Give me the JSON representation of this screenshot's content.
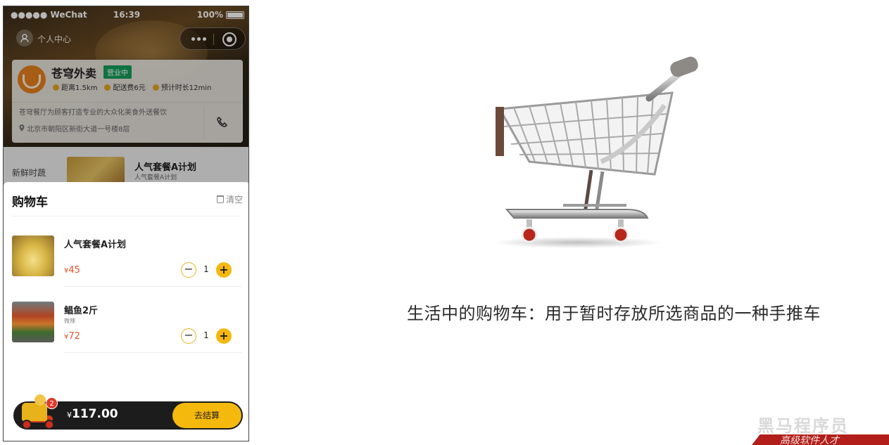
{
  "status_bar": {
    "carrier": "●●●●● WeChat",
    "time": "16:39",
    "battery": "100%"
  },
  "nav": {
    "profile_label": "个人中心"
  },
  "shop": {
    "name": "苍穹外卖",
    "status_badge": "营业中",
    "distance": "距离1.5km",
    "delivery_fee": "配送费6元",
    "eta": "预计时长12min",
    "description": "苍穹餐厅为顾客打造专业的大众化美食外送餐饮",
    "address": "北京市朝阳区新街大道一号楼8层"
  },
  "menu_peek": {
    "category": "新鲜时蔬",
    "dish_name": "人气套餐A计划",
    "dish_sub": "人气套餐A计划"
  },
  "cart": {
    "title": "购物车",
    "clear_label": "清空",
    "items": [
      {
        "name": "人气套餐A计划",
        "sub": "",
        "currency": "¥",
        "price": "45",
        "qty": "1"
      },
      {
        "name": "鲳鱼2斤",
        "sub": "微辣",
        "currency": "¥",
        "price": "72",
        "qty": "1"
      }
    ],
    "badge_count": "2",
    "total_currency": "¥",
    "total": "117.00",
    "checkout_label": "去结算"
  },
  "caption": "生活中的购物车：用于暂时存放所选商品的一种手推车",
  "watermark": "黑马程序员",
  "banner": "高级软件人才"
}
